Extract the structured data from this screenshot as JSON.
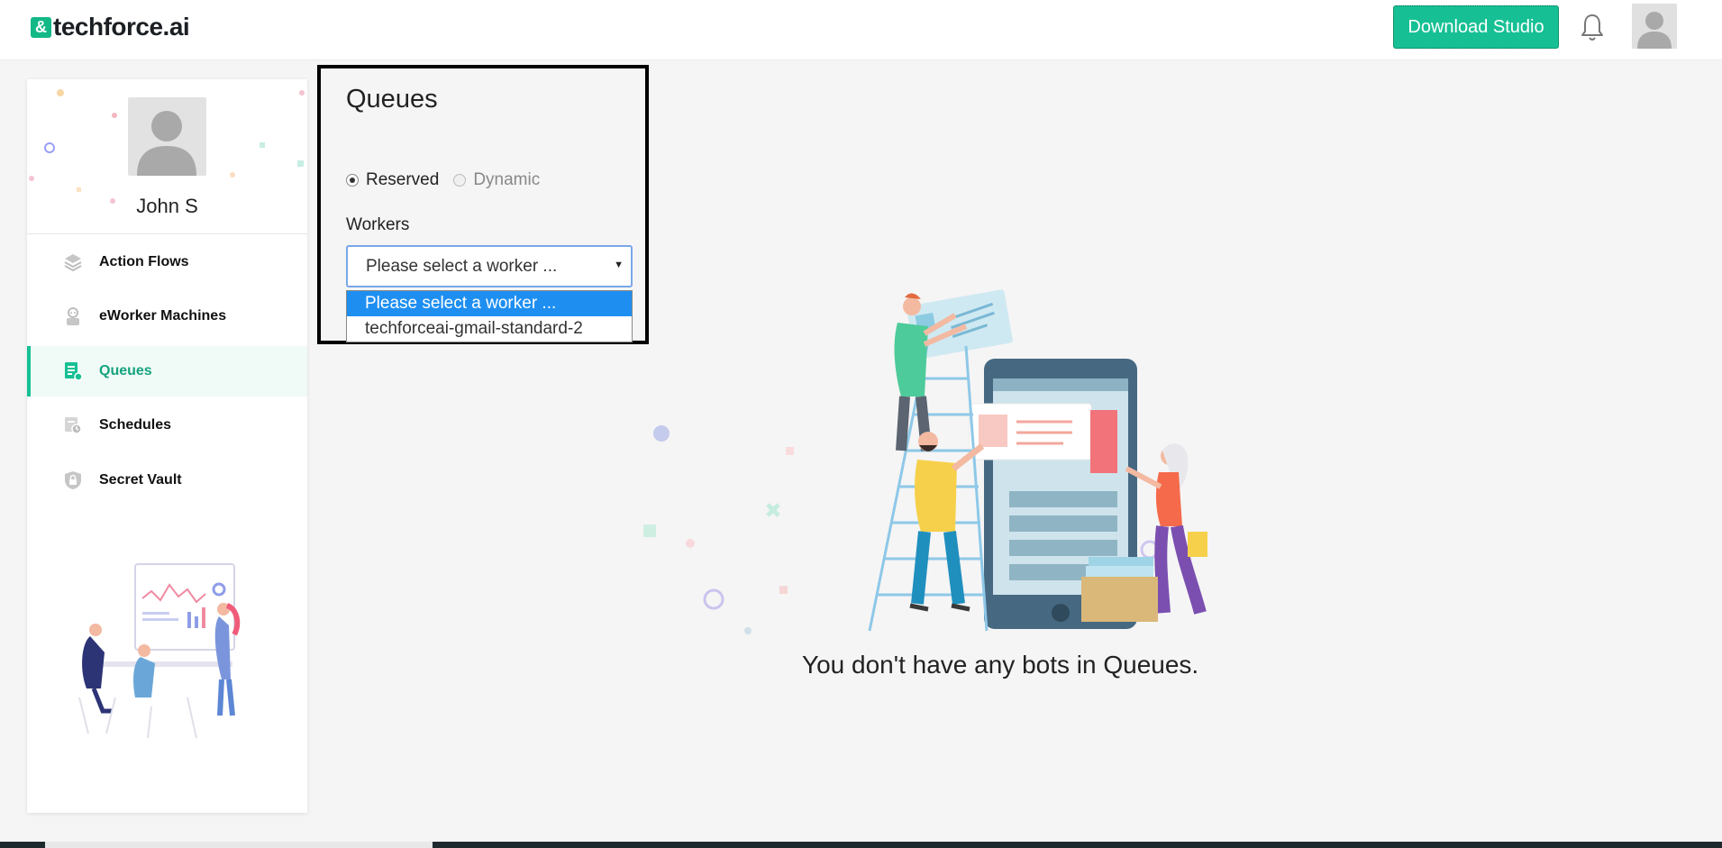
{
  "header": {
    "logo_mark": "&",
    "logo_text": "techforce.ai",
    "download_label": "Download Studio"
  },
  "sidebar": {
    "user_name": "John S",
    "items": [
      {
        "label": "Action Flows",
        "icon": "layers-icon"
      },
      {
        "label": "eWorker Machines",
        "icon": "robot-icon"
      },
      {
        "label": "Queues",
        "icon": "queue-icon",
        "active": true
      },
      {
        "label": "Schedules",
        "icon": "schedule-icon"
      },
      {
        "label": "Secret Vault",
        "icon": "shield-lock-icon"
      }
    ]
  },
  "queues": {
    "title": "Queues",
    "radio_reserved": "Reserved",
    "radio_dynamic": "Dynamic",
    "selected_mode": "Reserved",
    "workers_label": "Workers",
    "select_value": "Please select a worker ...",
    "options": [
      "Please select a worker ...",
      "techforceai-gmail-standard-2"
    ]
  },
  "empty_state": {
    "message": "You don't have any bots in Queues."
  },
  "colors": {
    "accent": "#16c094",
    "dropdown_highlight": "#1e8ff1"
  }
}
